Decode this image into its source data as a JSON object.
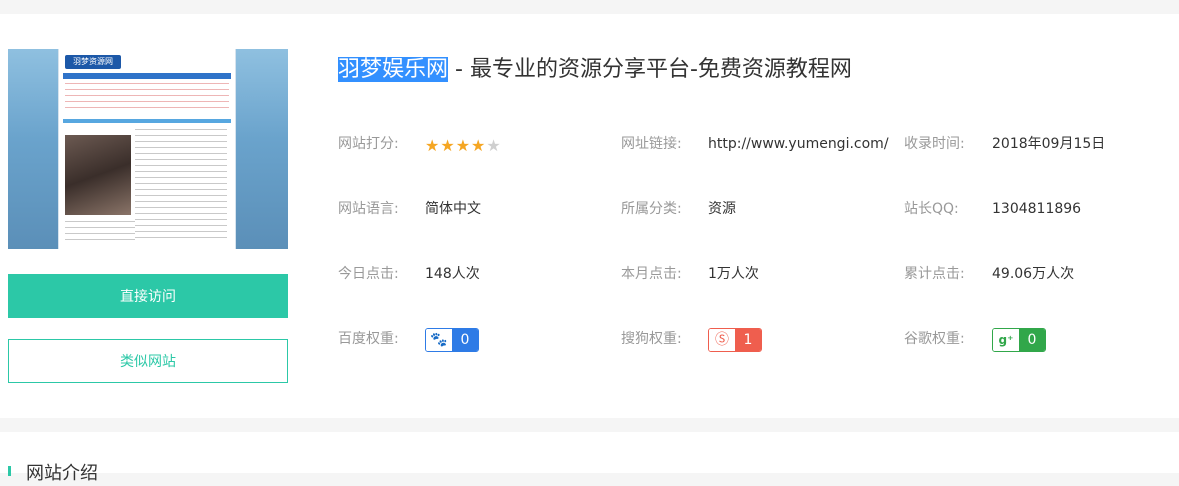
{
  "site": {
    "name_highlight": "羽梦娱乐网",
    "name_rest": " - 最专业的资源分享平台-免费资源教程网",
    "thumb_logo": "羽梦资源网"
  },
  "buttons": {
    "visit": "直接访问",
    "similar": "类似网站"
  },
  "rating": {
    "label": "网站打分:",
    "stars": 4,
    "max": 5
  },
  "fields": {
    "url_label": "网址链接:",
    "url_value": "http://www.yumengi.com/",
    "date_label": "收录时间:",
    "date_value": "2018年09月15日",
    "lang_label": "网站语言:",
    "lang_value": "简体中文",
    "cat_label": "所属分类:",
    "cat_value": "资源",
    "qq_label": "站长QQ:",
    "qq_value": "1304811896",
    "today_label": "今日点击:",
    "today_value": "148人次",
    "month_label": "本月点击:",
    "month_value": "1万人次",
    "total_label": "累计点击:",
    "total_value": "49.06万人次",
    "baidu_label": "百度权重:",
    "baidu_value": "0",
    "sogou_label": "搜狗权重:",
    "sogou_value": "1",
    "google_label": "谷歌权重:",
    "google_value": "0"
  },
  "icons": {
    "baidu": "paw-icon",
    "sogou": "sogou-s-icon",
    "google": "google-plus-icon"
  },
  "colors": {
    "accent": "#2cc8a7",
    "highlight": "#3390ff",
    "star": "#f5a623",
    "baidu": "#2e7be6",
    "sogou": "#ef5e4e",
    "google": "#31a74a"
  },
  "section2": {
    "title": "网站介绍"
  }
}
